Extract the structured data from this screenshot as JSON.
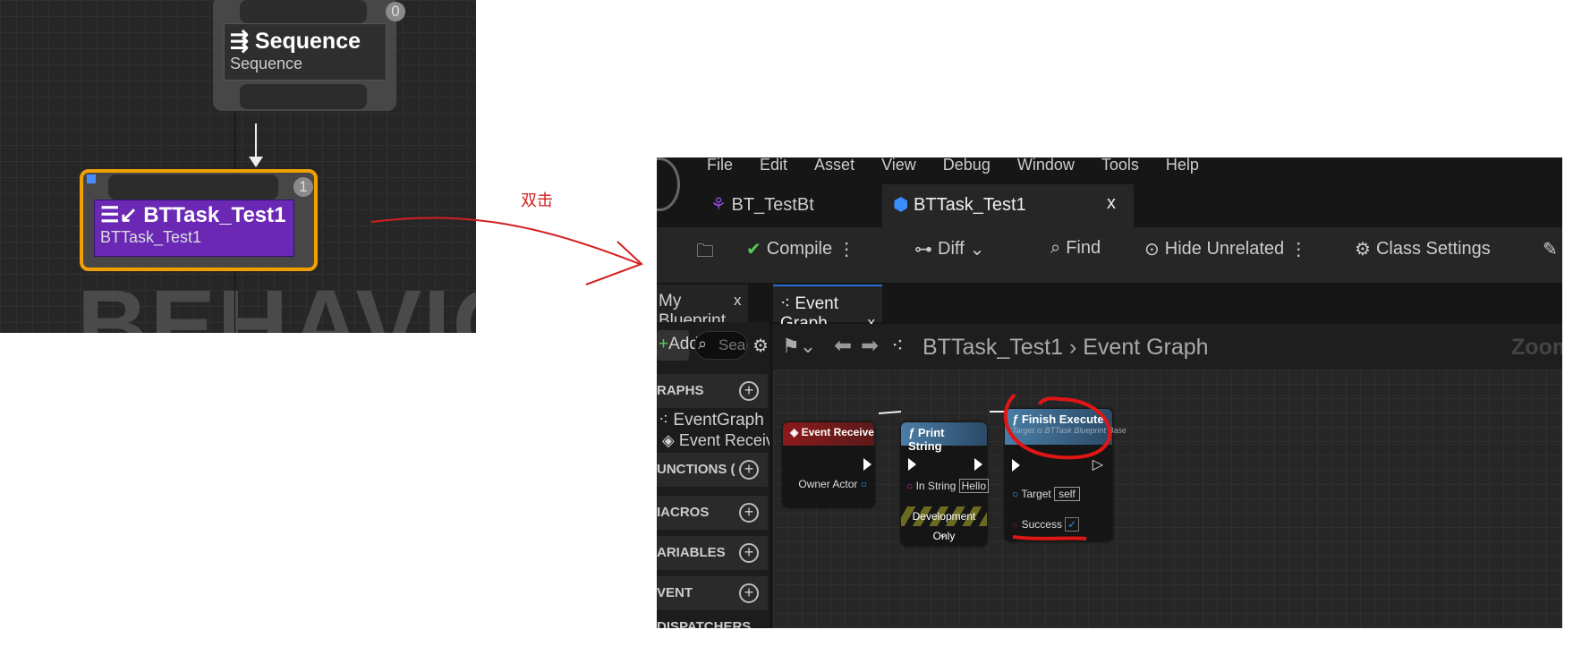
{
  "behavior_tree": {
    "watermark": "BEHAVIOR T",
    "sequence": {
      "title": "Sequence",
      "subtitle": "Sequence",
      "index": "0"
    },
    "task": {
      "title": "BTTask_Test1",
      "subtitle": "BTTask_Test1",
      "index": "1"
    }
  },
  "annotation": {
    "label": "双击",
    "color": "#d42020"
  },
  "editor": {
    "menu": [
      "File",
      "Edit",
      "Asset",
      "View",
      "Debug",
      "Window",
      "Tools",
      "Help"
    ],
    "tabs": [
      {
        "label": "BT_TestBt"
      },
      {
        "label": "BTTask_Test1",
        "close": "x"
      }
    ],
    "toolbar": {
      "compile": "Compile",
      "diff": "Diff",
      "find": "Find",
      "hide_unrelated": "Hide Unrelated",
      "class_settings": "Class Settings"
    },
    "my_blueprint": {
      "title": "My Blueprint",
      "close": "x",
      "add": "Add",
      "search_placeholder": "Searc",
      "sections": [
        "RAPHS",
        "UNCTIONS (",
        "IACROS",
        "ARIABLES",
        "VENT DISPATCHERS"
      ],
      "graphs": [
        "EventGraph",
        "Event Receive Execute"
      ]
    },
    "graph_tab": {
      "title": "Event Graph",
      "close": "x"
    },
    "breadcrumb": {
      "asset": "BTTask_Test1",
      "graph": "Event Graph",
      "zoom": "Zoom"
    },
    "nodes": {
      "event": {
        "title": "Event Receive Execute",
        "pin": "Owner Actor",
        "color": "#8b1a1a"
      },
      "print": {
        "title": "Print String",
        "pin": "In String",
        "value": "Hello",
        "footer": "Development Only",
        "color": "#3b6b8f"
      },
      "finish": {
        "title": "Finish Execute",
        "subtitle": "Target is BTTask Blueprint Base",
        "target_pin": "Target",
        "target_value": "self",
        "success_pin": "Success",
        "success_checked": true,
        "color": "#3b6b8f"
      }
    }
  }
}
